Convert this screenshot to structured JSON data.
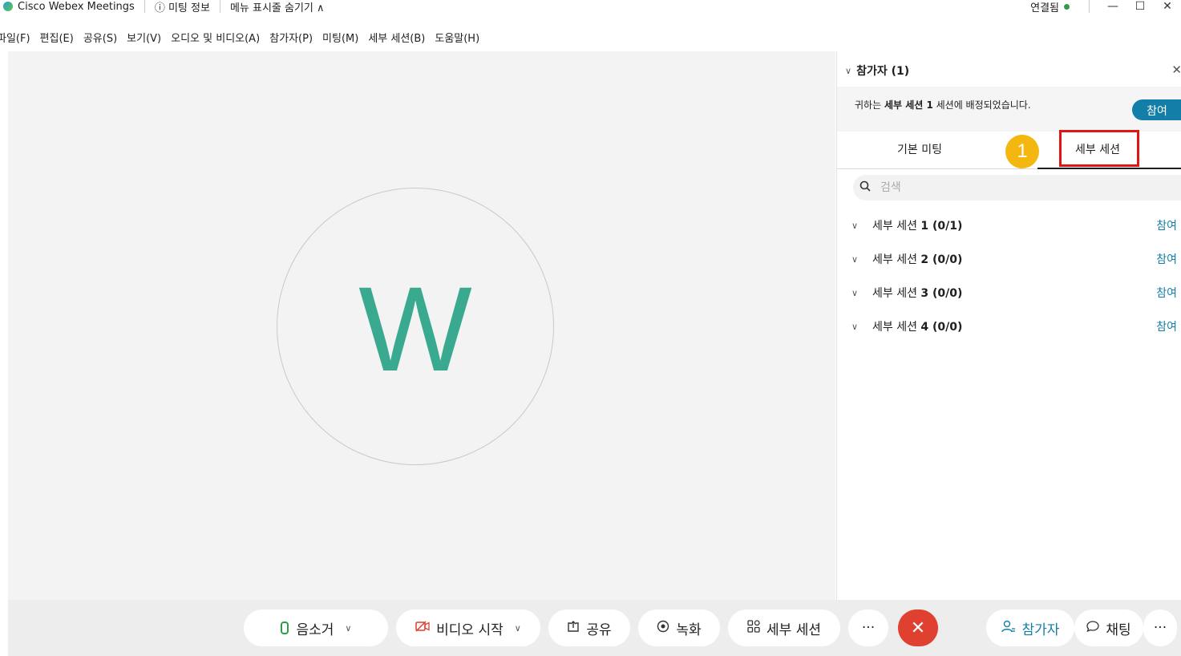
{
  "titlebar": {
    "app_name": "Cisco Webex Meetings",
    "meeting_info": "ⓘ 미팅 정보",
    "hide_menu": "메뉴 표시줄 숨기기 ∧",
    "connection_status": "연결됨",
    "minimize": "—",
    "maximize": "☐",
    "close": "✕"
  },
  "menubar": {
    "items": [
      "파일(F)",
      "편집(E)",
      "공유(S)",
      "보기(V)",
      "오디오 및 비디오(A)",
      "참가자(P)",
      "미팅(M)",
      "세부 세션(B)",
      "도움말(H)"
    ]
  },
  "stage": {
    "avatar_letter": "W"
  },
  "panel": {
    "title": "참가자 (1)",
    "close": "✕",
    "notice_prefix": "귀하는 ",
    "notice_bold": "세부 세션 1",
    "notice_suffix": " 세션에 배정되었습니다.",
    "notice_join": "참여",
    "tabs": {
      "main": "기본 미팅",
      "breakout": "세부 세션"
    },
    "step_badge": "1",
    "search_placeholder": "검색",
    "sessions": [
      {
        "name": "세부 세션 ",
        "count": "1 (0/1)",
        "join": "참여"
      },
      {
        "name": "세부 세션 ",
        "count": "2 (0/0)",
        "join": "참여"
      },
      {
        "name": "세부 세션 ",
        "count": "3 (0/0)",
        "join": "참여"
      },
      {
        "name": "세부 세션 ",
        "count": "4 (0/0)",
        "join": "참여"
      }
    ]
  },
  "controls": {
    "mute": "음소거",
    "video": "비디오 시작",
    "share": "공유",
    "record": "녹화",
    "breakout": "세부 세션",
    "more": "···",
    "end": "✕",
    "participants": "참가자",
    "chat": "채팅",
    "more_right": "···"
  },
  "colors": {
    "accent": "#137fa8",
    "avatar_letter": "#39a98f",
    "end_button": "#e0402f",
    "highlight": "#e21414",
    "badge": "#f3b70f"
  }
}
